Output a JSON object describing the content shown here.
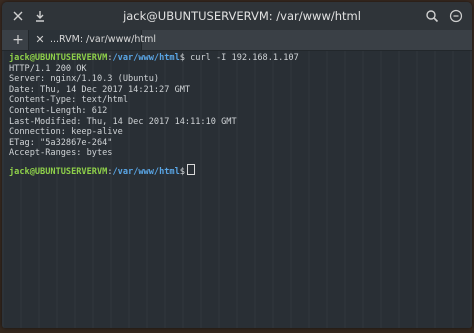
{
  "window": {
    "title": "jack@UBUNTUSERVERVM: /var/www/html"
  },
  "titlebar": {
    "left_icons": [
      "close-icon",
      "download-icon"
    ],
    "right_icons": [
      "search-icon",
      "menu-icon"
    ]
  },
  "tabbar": {
    "add_label": "+",
    "tab": {
      "close_label": "✕",
      "label": "...RVM: /var/www/html"
    }
  },
  "terminal": {
    "prompt_user": "jack@UBUNTUSERVERVM",
    "prompt_sep": ":",
    "prompt_path": "/var/www/html",
    "prompt_symbol": "$",
    "command": " curl -I 192.168.1.107",
    "output": [
      "HTTP/1.1 200 OK",
      "Server: nginx/1.10.3 (Ubuntu)",
      "Date: Thu, 14 Dec 2017 14:21:27 GMT",
      "Content-Type: text/html",
      "Content-Length: 612",
      "Last-Modified: Thu, 14 Dec 2017 14:11:10 GMT",
      "Connection: keep-alive",
      "ETag: \"5a32867e-264\"",
      "Accept-Ranges: bytes"
    ],
    "second_prompt_user": "jack@UBUNTUSERVERVM",
    "second_prompt_sep": ":",
    "second_prompt_path": "/var/www/html",
    "second_prompt_symbol": "$"
  },
  "colors": {
    "prompt_user": "#8ed04a",
    "prompt_path": "#5aa6e6",
    "background": "#2a3036"
  }
}
